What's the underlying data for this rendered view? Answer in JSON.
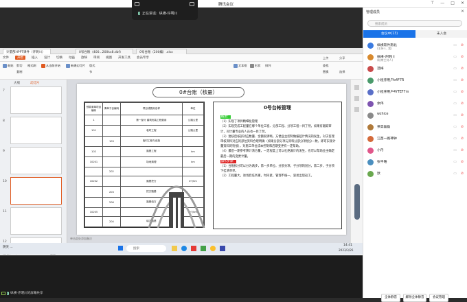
{
  "window": {
    "title": "腾讯会议"
  },
  "speaking": {
    "label": "正在讲话:",
    "name": "纵横-许明川"
  },
  "browser_tabs": [
    "计量部HPPT课件（许明川）",
    "0号台账（400...200kx8.dbf）",
    "0号台账（200编）.xlsx"
  ],
  "menu": [
    "文件",
    "开始",
    "插入",
    "设计",
    "切换",
    "动画",
    "放映",
    "审阅",
    "视图",
    "开发工具",
    "会员专享"
  ],
  "menu_active": "开始",
  "ribbon": {
    "paste": "粘贴",
    "cut": "剪切",
    "copy": "复制",
    "format": "格式刷",
    "from_start": "从当前开始",
    "new_slide": "新建幻灯片",
    "layout": "版式",
    "section": "节",
    "textbox": "文本框",
    "shape": "形状",
    "arrange": "排列",
    "find": "查找",
    "replace": "替换",
    "select": "选择",
    "upload": "上传",
    "share": "分享"
  },
  "panel_left": {
    "tab1": "大纲",
    "tab2": "幻灯片"
  },
  "thumbs": [
    {
      "num": "7"
    },
    {
      "num": "8"
    },
    {
      "num": "9"
    },
    {
      "num": "10"
    },
    {
      "num": "11"
    },
    {
      "num": "12"
    },
    {
      "num": "13"
    }
  ],
  "slide": {
    "title": "0#台账（核量）",
    "table_headers": [
      "预算清单项目编码",
      "清单子目编码",
      "项目或费用名称",
      "单位"
    ],
    "table_rows": [
      [
        "1",
        "",
        "第一部分  建筑安装工程费用",
        "公路公里"
      ],
      [
        "101",
        "",
        "临时工程",
        "公路公里"
      ],
      [
        "",
        "103",
        "临时工程与设施",
        ""
      ],
      [
        "102",
        "",
        "路基工程",
        "km"
      ],
      [
        "10201",
        "",
        "场地清理",
        "km"
      ],
      [
        "",
        "202",
        "",
        ""
      ],
      [
        "10202",
        "",
        "路基挖方",
        "m³/km"
      ],
      [
        "",
        "203",
        "挖方路基",
        ""
      ],
      [
        "",
        "206",
        "路基填方",
        ""
      ],
      [
        "10205",
        "",
        "",
        "m³/km"
      ],
      [
        "",
        "204",
        "填方路基",
        ""
      ]
    ],
    "notes_title": "0号台帐管理",
    "notes_tag1": "概述：",
    "notes_body1": "（1）实现了项目精细化管理\n（2）实现完成工程量在哪个单位工程、分部工程、分项工程一目了然，如果有跟踪审计，对计量专业的人员也一目了然。\n（3）复核后核部对应数量、金额很清晰。方便业主控制做报超计情况的发生，对于监理审核资料对应的部位资料合理明确（如果分部分项与资料分部分项划分一致，即可实现计量资料的衔接），对施工单位成本控制和后期变更有一定帮助。\n（4）最后一期参考算计清方量，一定程度上可以杜绝漏计的发生，也可以帮助业主确定最后一期的变更计量。",
    "notes_tag2": "操作步骤：",
    "notes_body2": "（1）台账拆分可以分为两步，第一步单位、分部分项，子分项的划分，第二步，子分项下挂清单单。\n（2）工程量大，进场后任务重，时间紧，管理不统一，容易出现返工。"
  },
  "slide_note": "单击此处添加备注",
  "status": {
    "page": "幻灯片 11 / 43",
    "theme": "Office 主题",
    "zoom": "70%"
  },
  "taskbar": {
    "search": "搜索",
    "time": "14:41",
    "date": "2023/3/26",
    "weather": "阴天 ..."
  },
  "share_user": "纵横-许明川的屏幕共享",
  "panel": {
    "title": "管理成员",
    "search_placeholder": "搜索成员",
    "tab_in": "会议中(13)",
    "tab_out": "未入会",
    "members": [
      {
        "name": "纵横软件南北",
        "sub": "(主持人, 我)",
        "color": "#3b7be0"
      },
      {
        "name": "纵横-许明川",
        "sub": "(联席主持人)",
        "color": "#d88a2e"
      },
      {
        "name": "范梅",
        "sub": "",
        "color": "#c94b4b"
      },
      {
        "name": "小程序用户b4F7R",
        "sub": "",
        "color": "#4a9a6b"
      },
      {
        "name": "小程序用户4YTEF7m",
        "sub": "",
        "color": "#5a6fc8"
      },
      {
        "name": "余伟",
        "sub": "",
        "color": "#7e54b0"
      },
      {
        "name": "wzhice",
        "sub": "",
        "color": "#8a8a8a"
      },
      {
        "name": "茶高磊磊",
        "sub": "",
        "color": "#b07a3a"
      },
      {
        "name": "江西一路神钟",
        "sub": "",
        "color": "#d46a3a"
      },
      {
        "name": "小丹",
        "sub": "",
        "color": "#e0578a"
      },
      {
        "name": "张平略",
        "sub": "",
        "color": "#4b8fbf"
      },
      {
        "name": "默",
        "sub": "",
        "color": "#6aa84f"
      }
    ],
    "btn_mute_all": "全体静音",
    "btn_unmute_all": "解除全体静音",
    "btn_manage": "会议管理"
  },
  "colors": {
    "accent": "#1a73e8",
    "brand_orange": "#e05a20"
  }
}
